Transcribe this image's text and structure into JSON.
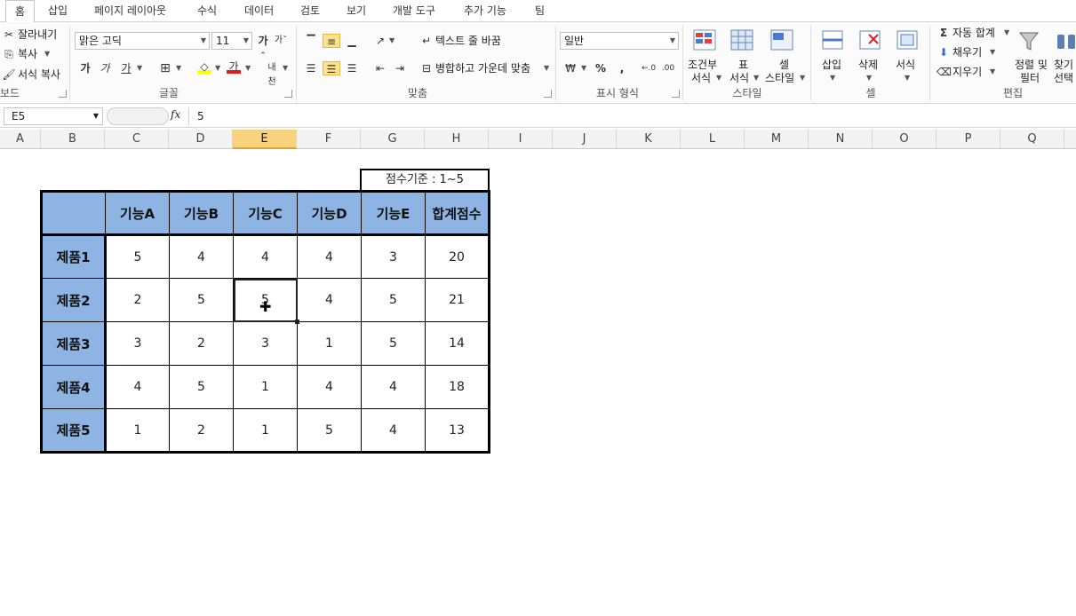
{
  "tabs": [
    "홈",
    "삽입",
    "페이지 레이아웃",
    "수식",
    "데이터",
    "검토",
    "보기",
    "개발 도구",
    "추가 기능",
    "팀"
  ],
  "clipboard": {
    "cut": "잘라내기",
    "copy": "복사",
    "format_painter": "서식 복사",
    "label": "보드"
  },
  "font": {
    "name": "맑은 고딕",
    "size": "11",
    "bold": "가",
    "italic": "가",
    "underline": "가",
    "label": "글꼴",
    "font_color_glyph": "가",
    "highlight_glyph": "ab",
    "phonetic": "내천"
  },
  "alignment": {
    "wrap_text": "텍스트 줄 바꿈",
    "merge_center": "병합하고 가운데 맞춤",
    "label": "맞춤"
  },
  "number": {
    "format": "일반",
    "percent": "%",
    "comma": ",",
    "label": "표시 형식"
  },
  "styles": {
    "conditional": "조건부 서식",
    "conditional_1": "조건부",
    "conditional_2": "서식",
    "table_1": "표",
    "table_2": "서식",
    "cell_1": "셀",
    "cell_2": "스타일",
    "label": "스타일"
  },
  "cells": {
    "insert": "삽입",
    "delete": "삭제",
    "format": "서식",
    "label": "셀"
  },
  "editing": {
    "autosum": "자동 합계",
    "fill": "채우기",
    "clear": "지우기",
    "sort_1": "정렬 및",
    "sort_2": "필터",
    "find_1": "찾기",
    "find_2": "선택",
    "label": "편집"
  },
  "formula_bar": {
    "name_box": "E5",
    "fx": "fx",
    "value": "5"
  },
  "columns": [
    "A",
    "B",
    "C",
    "D",
    "E",
    "F",
    "G",
    "H",
    "I",
    "J",
    "K",
    "L",
    "M",
    "N",
    "O",
    "P",
    "Q"
  ],
  "selected_column": "E",
  "criteria_note": "점수기준 : 1~5",
  "table": {
    "headers": [
      "기능A",
      "기능B",
      "기능C",
      "기능D",
      "기능E",
      "합계점수"
    ],
    "rows": [
      {
        "label": "제품1",
        "values": [
          "5",
          "4",
          "4",
          "4",
          "3",
          "20"
        ]
      },
      {
        "label": "제품2",
        "values": [
          "2",
          "5",
          "5",
          "4",
          "5",
          "21"
        ]
      },
      {
        "label": "제품3",
        "values": [
          "3",
          "2",
          "3",
          "1",
          "5",
          "14"
        ]
      },
      {
        "label": "제품4",
        "values": [
          "4",
          "5",
          "1",
          "4",
          "4",
          "18"
        ]
      },
      {
        "label": "제품5",
        "values": [
          "1",
          "2",
          "1",
          "5",
          "4",
          "13"
        ]
      }
    ]
  },
  "colors": {
    "header_fill": "#8eb4e3",
    "selected_column": "#f8d37e"
  }
}
